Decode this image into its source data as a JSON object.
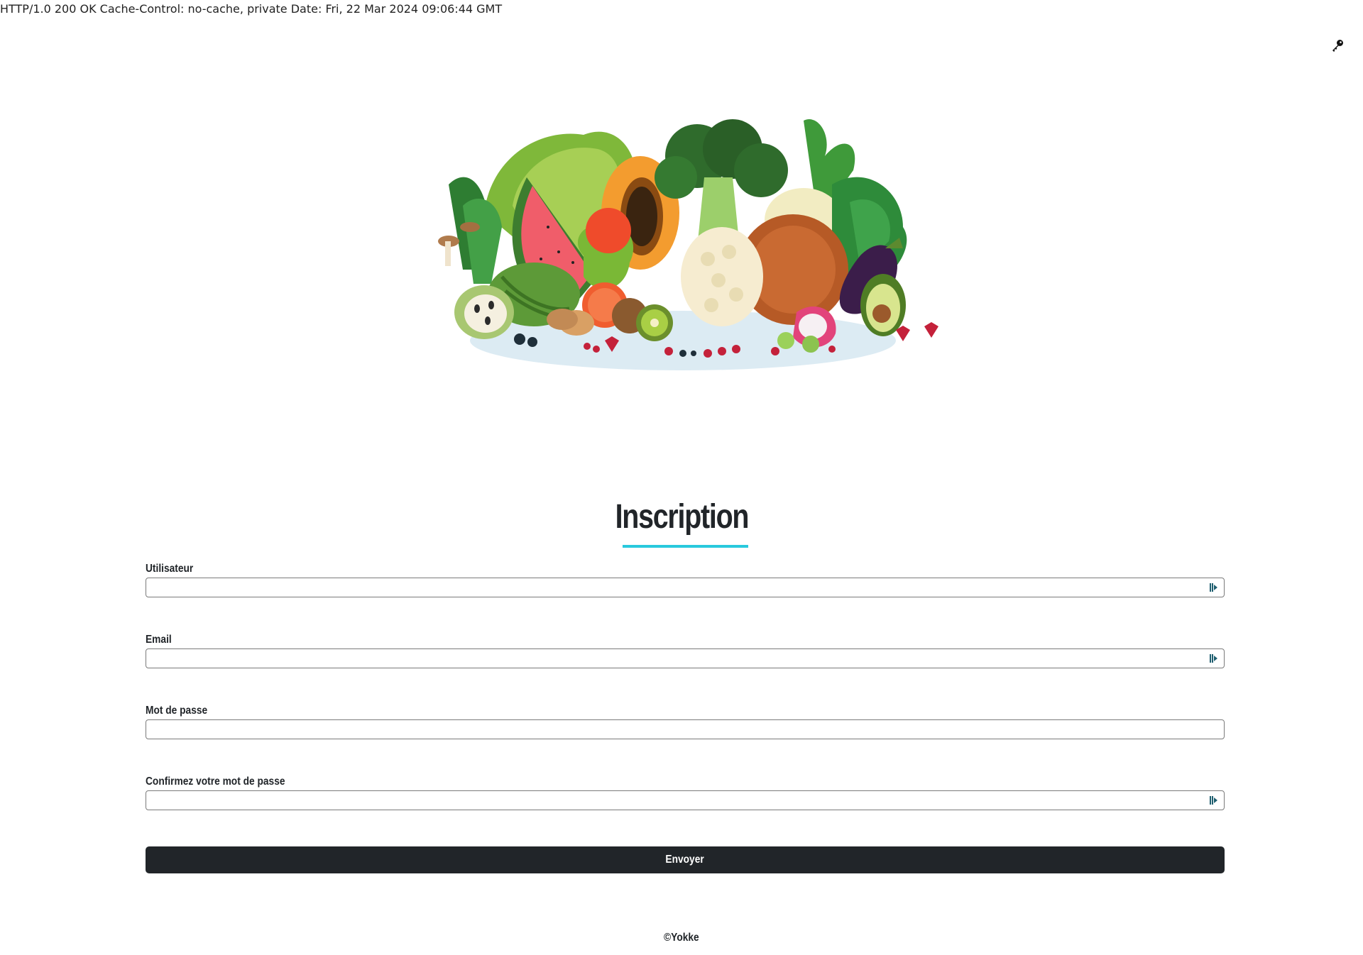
{
  "http_header_text": "HTTP/1.0 200 OK Cache-Control: no-cache, private Date: Fri, 22 Mar 2024 09:06:44 GMT",
  "icons": {
    "top_right": "key-icon",
    "field_autofill": "password-manager-icon"
  },
  "hero": {
    "image": "vegetables-and-fruits-illustration"
  },
  "page_title": "Inscription",
  "colors": {
    "accent": "#29c9dd",
    "button_bg": "#212529",
    "text": "#212529"
  },
  "form": {
    "fields": [
      {
        "label": "Utilisateur",
        "value": "",
        "has_manager_icon": true
      },
      {
        "label": "Email",
        "value": "",
        "has_manager_icon": true
      },
      {
        "label": "Mot de passe",
        "value": "",
        "has_manager_icon": false
      },
      {
        "label": "Confirmez votre mot de passe",
        "value": "",
        "has_manager_icon": true
      }
    ],
    "submit_label": "Envoyer"
  },
  "footer": {
    "text": "©Yokke"
  }
}
